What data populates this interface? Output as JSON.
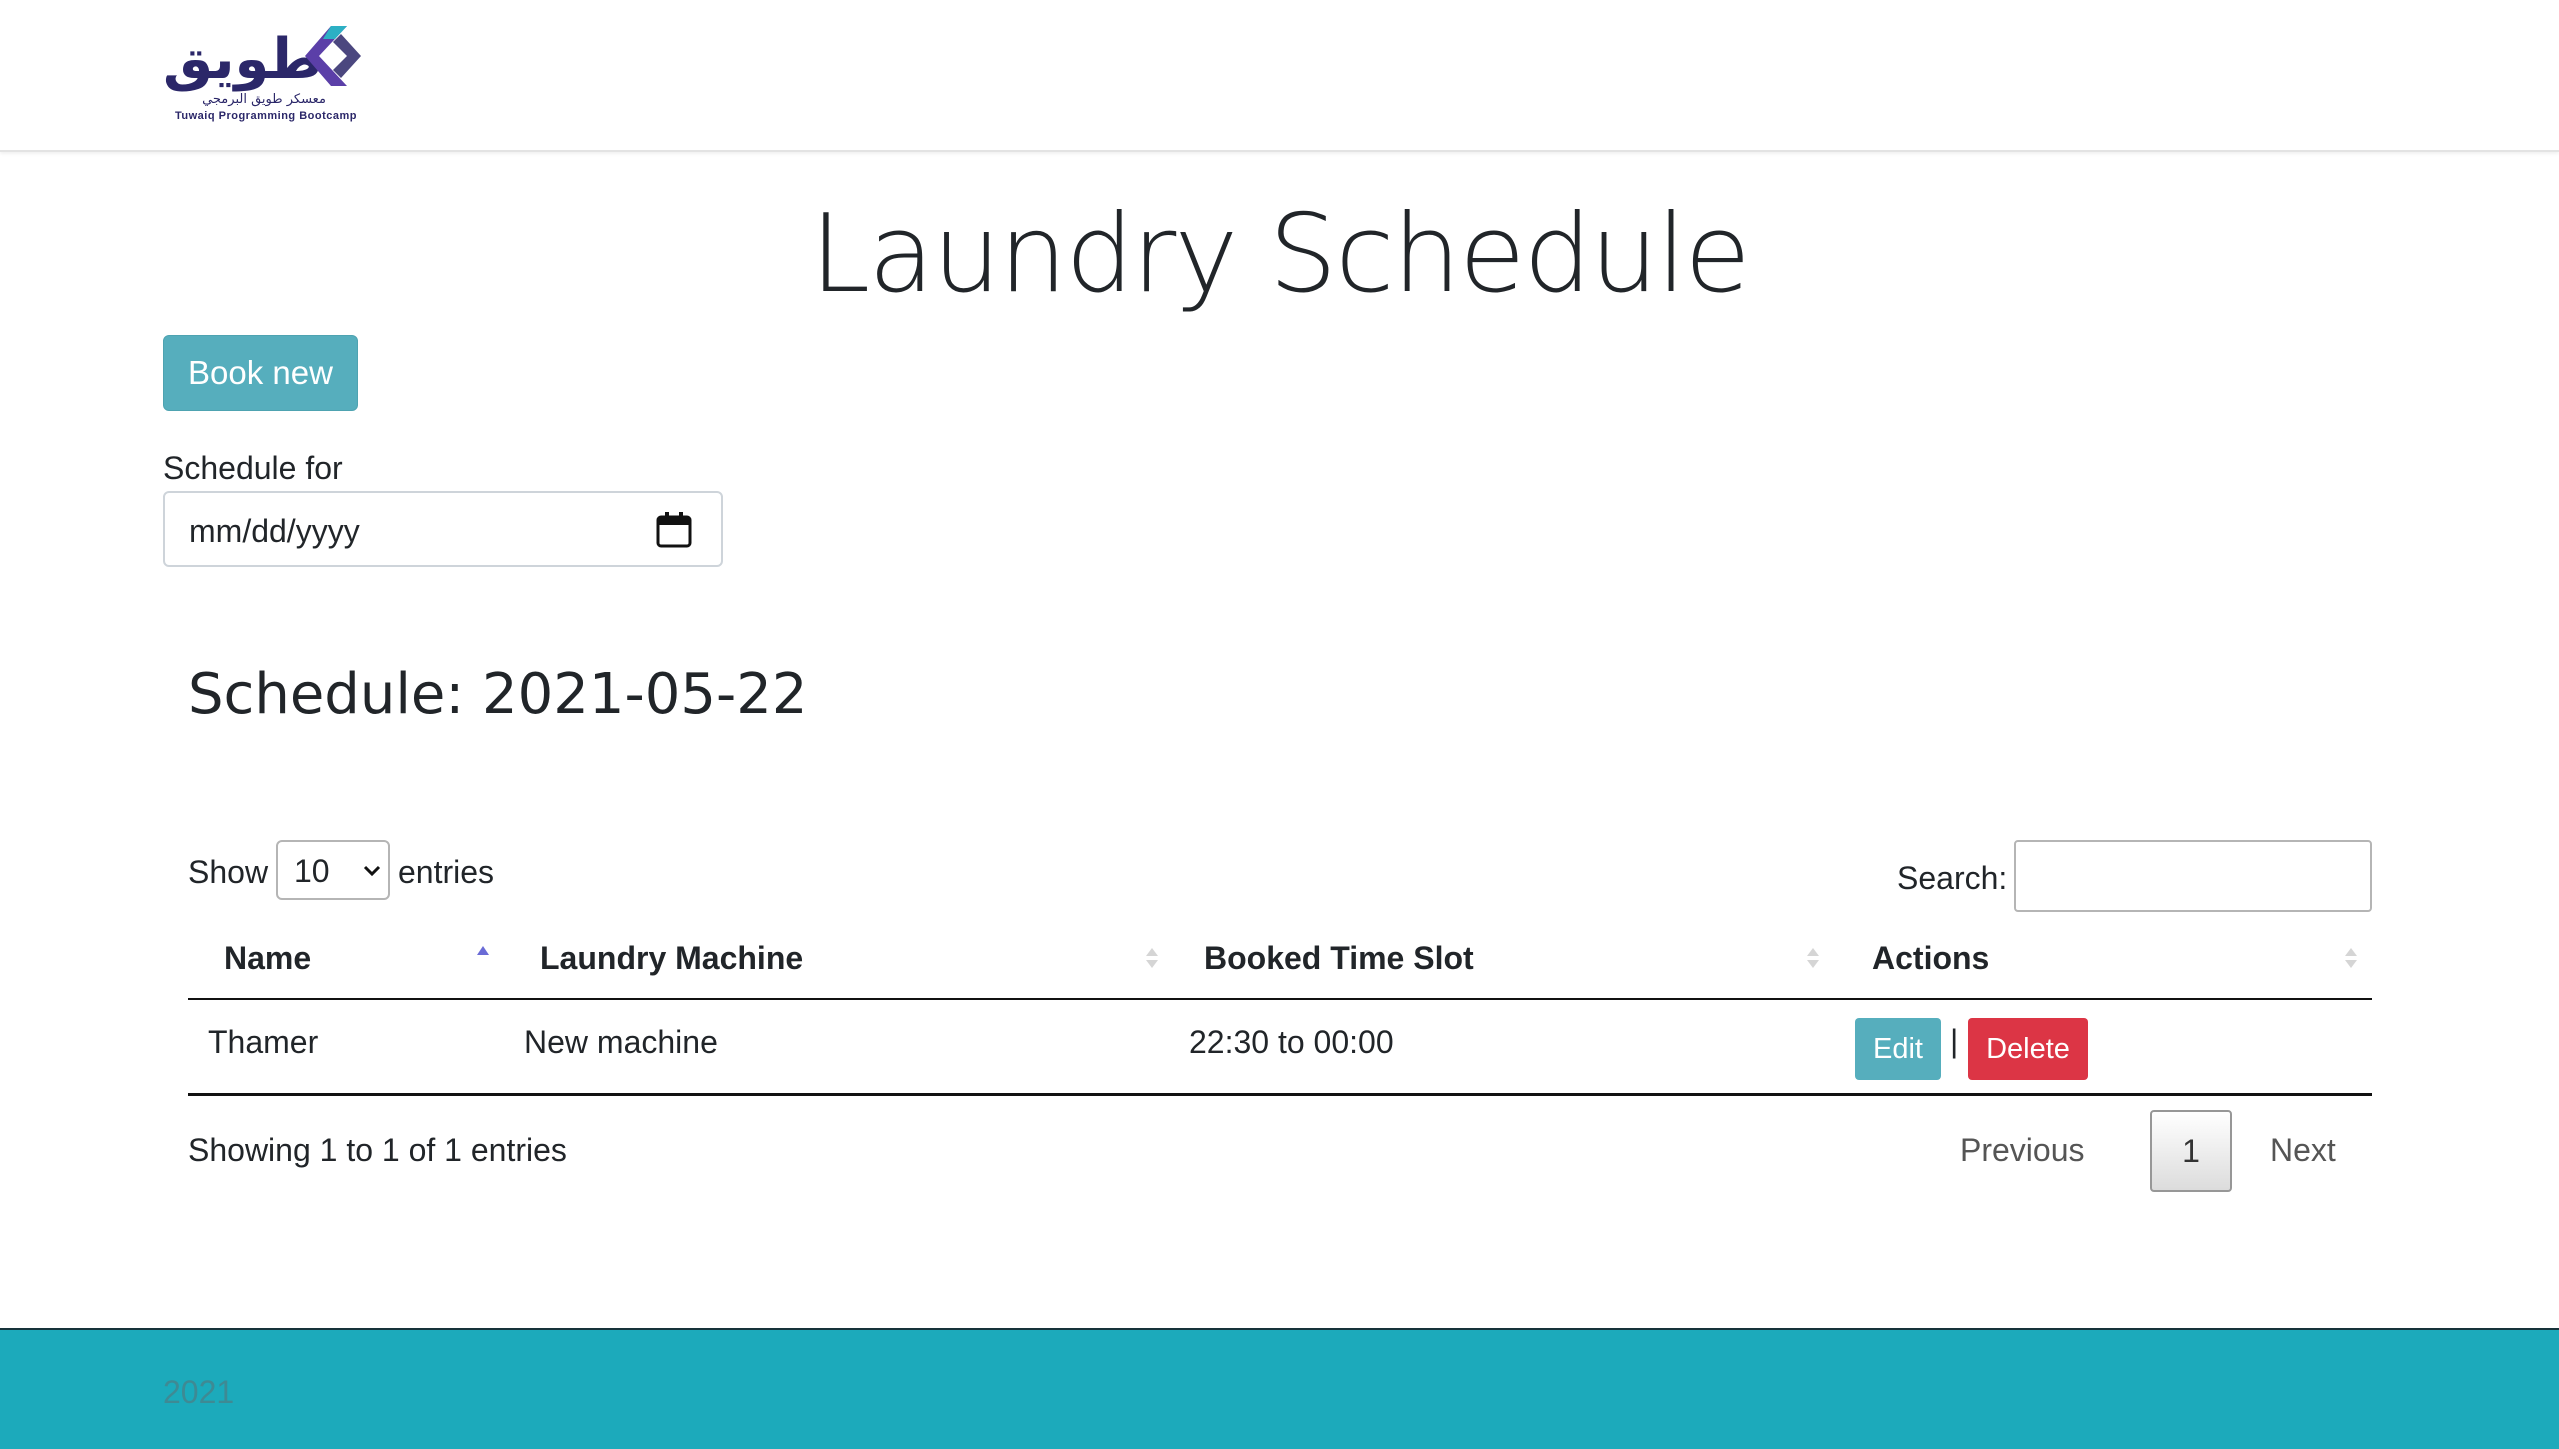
{
  "brand": {
    "arabic_name": "طويق",
    "arabic_subtitle": "معسكر طويق البرمجي",
    "english_name": "Tuwaiq Programming Bootcamp",
    "accent_colors": [
      "#2b2769",
      "#5b3fa8",
      "#2cb0c4"
    ]
  },
  "page": {
    "title": "Laundry Schedule"
  },
  "actions": {
    "book_new_label": "Book new"
  },
  "schedule_for": {
    "label": "Schedule for",
    "date_placeholder": "mm/dd/yyyy",
    "icon": "calendar-icon"
  },
  "schedule": {
    "heading": "Schedule: 2021-05-22"
  },
  "table_controls": {
    "show_label": "Show",
    "entries_label": "entries",
    "page_length": "10",
    "search_label": "Search:",
    "search_value": ""
  },
  "table": {
    "columns": [
      "Name",
      "Laundry Machine",
      "Booked Time Slot",
      "Actions"
    ],
    "sorted_column": "Name",
    "sort_direction": "ascending",
    "rows": [
      {
        "name": "Thamer",
        "machine": "New machine",
        "time_slot": "22:30 to 00:00",
        "edit_label": "Edit",
        "separator": "|",
        "delete_label": "Delete"
      }
    ]
  },
  "table_info": "Showing 1 to 1 of 1 entries",
  "pagination": {
    "previous": "Previous",
    "current": "1",
    "next": "Next"
  },
  "footer": {
    "year": "2021"
  },
  "colors": {
    "info_button": "#56aebd",
    "danger_button": "#dc3545",
    "footer_bg": "#1caabb",
    "sort_active": "#6a6bd6"
  }
}
